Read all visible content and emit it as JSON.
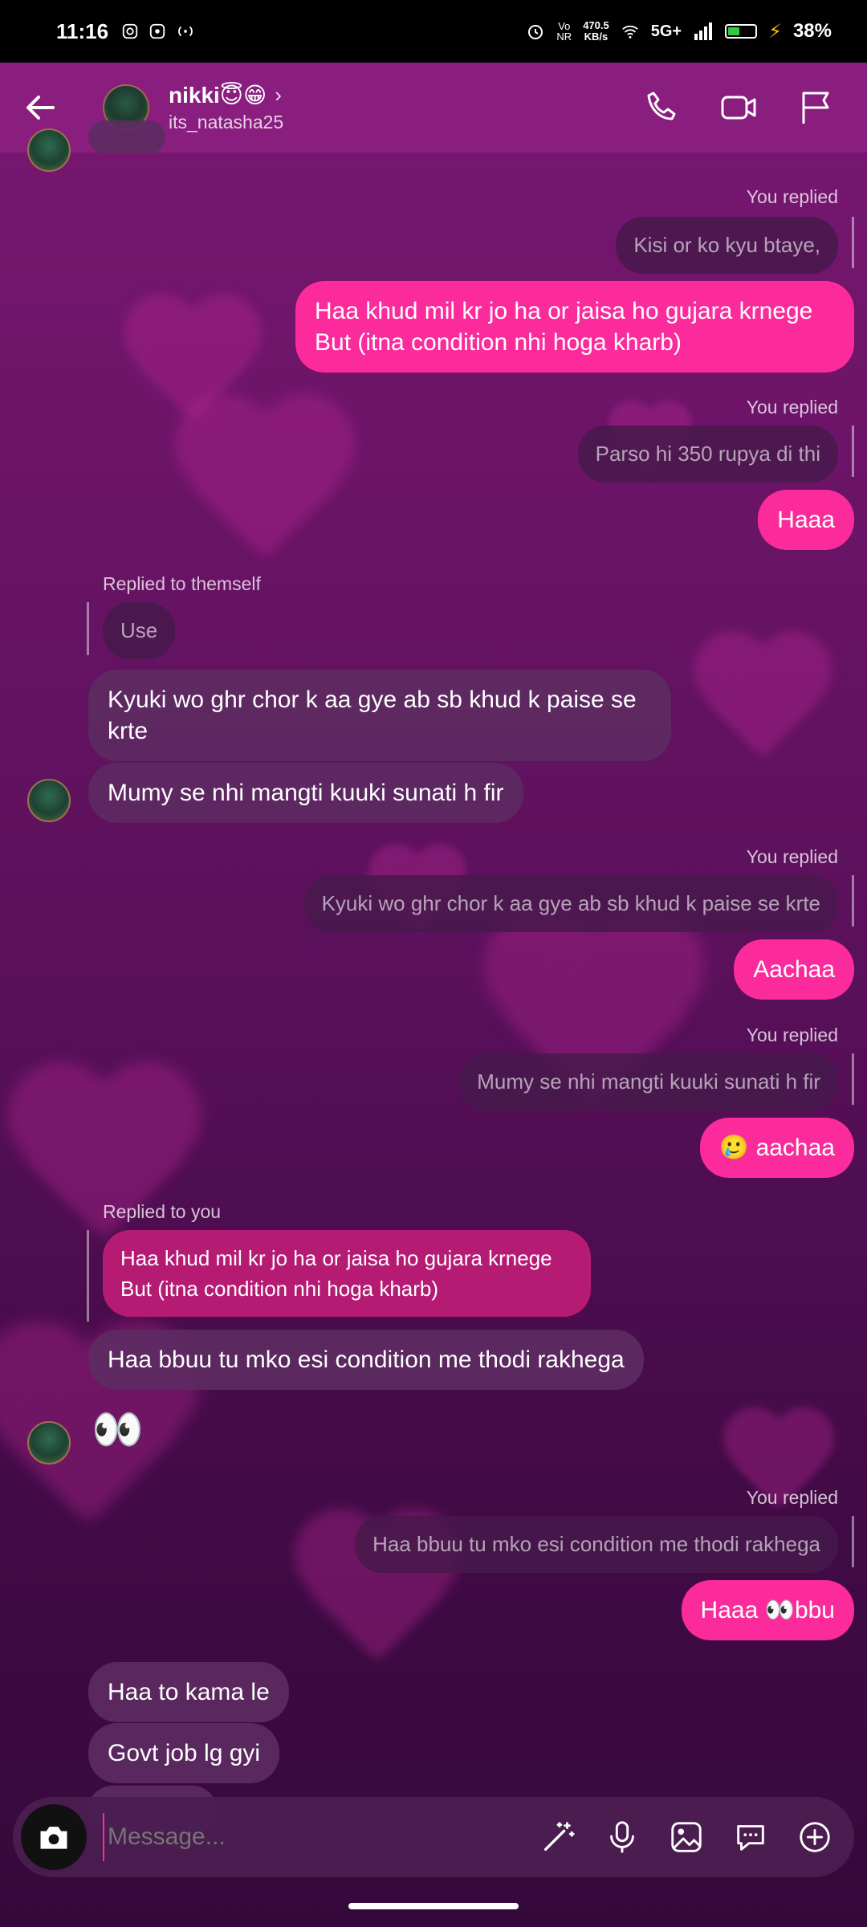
{
  "status_bar": {
    "time": "11:16",
    "net_rate": "470.5",
    "net_unit": "KB/s",
    "network": "5G+",
    "battery": "38%"
  },
  "header": {
    "name": "nikki😇😁",
    "username": "its_natasha25"
  },
  "messages": {
    "m1_label": "You replied",
    "m1_quote": "Kisi or ko kyu btaye,",
    "m1_text": "Haa khud mil kr jo ha or jaisa ho gujara krnege But (itna condition nhi hoga kharb)",
    "m2_label": "You replied",
    "m2_quote": "Parso hi 350 rupya di thi",
    "m2_text": "Haaa",
    "m3_label": "Replied to themself",
    "m3_quote": "Use",
    "m3_text_a": "Kyuki wo ghr chor k aa gye ab sb khud k paise se krte",
    "m3_text_b": "Mumy se nhi mangti kuuki sunati h fir",
    "m4_label": "You replied",
    "m4_quote": "Kyuki wo ghr chor k aa gye ab sb khud k paise se krte",
    "m4_text": "Aachaa",
    "m5_label": "You replied",
    "m5_quote": "Mumy se nhi mangti kuuki sunati h fir",
    "m5_text": "🥲 aachaa",
    "m6_label": "Replied to you",
    "m6_quote": "Haa khud mil kr jo ha or jaisa ho gujara krnege But (itna condition nhi hoga kharb)",
    "m6_text": "Haa bbuu tu mko esi condition me thodi rakhega",
    "m7_text": "👀",
    "m8_label": "You replied",
    "m8_quote": "Haa bbuu tu mko esi condition me thodi rakhega",
    "m8_text": "Haaa 👀bbu",
    "m9_text_a": "Haa to kama le",
    "m9_text_b": "Govt job lg gyi"
  },
  "composer": {
    "placeholder": "Message..."
  },
  "icons": {
    "header": [
      "back-arrow-icon",
      "phone-icon",
      "video-icon",
      "flag-icon"
    ],
    "composer": [
      "camera-icon",
      "magic-wand-icon",
      "microphone-icon",
      "gallery-icon",
      "sticker-chat-icon",
      "plus-circle-icon"
    ]
  },
  "colors": {
    "outgoing_bubble": "#fb2b9b",
    "incoming_bubble": "#5d2b62",
    "header_bg": "#8a1e7f"
  }
}
